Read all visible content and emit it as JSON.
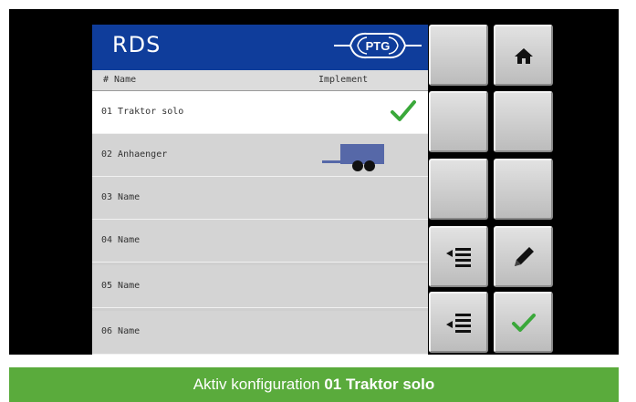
{
  "header": {
    "title": "RDS",
    "logo_text": "PTG"
  },
  "columns": {
    "name": "# Name",
    "implement": "Implement"
  },
  "rows": [
    {
      "label": "01 Traktor solo",
      "implement_icon": "check-icon",
      "selected": true
    },
    {
      "label": "02 Anhaenger",
      "implement_icon": "trailer-icon",
      "selected": false
    },
    {
      "label": "03 Name"
    },
    {
      "label": "04 Name"
    },
    {
      "label": "05 Name"
    },
    {
      "label": "06 Name"
    }
  ],
  "buttons": {
    "home": "home-icon",
    "insert_above": "insert-row-above-icon",
    "edit": "pencil-icon",
    "insert_below": "insert-row-below-icon",
    "confirm": "check-icon"
  },
  "colors": {
    "header_bg": "#0f3d9b",
    "status_bg": "#5aab3c",
    "check": "#3aa83a"
  },
  "status": {
    "prefix": "Aktiv konfiguration",
    "active": "01 Traktor solo"
  }
}
